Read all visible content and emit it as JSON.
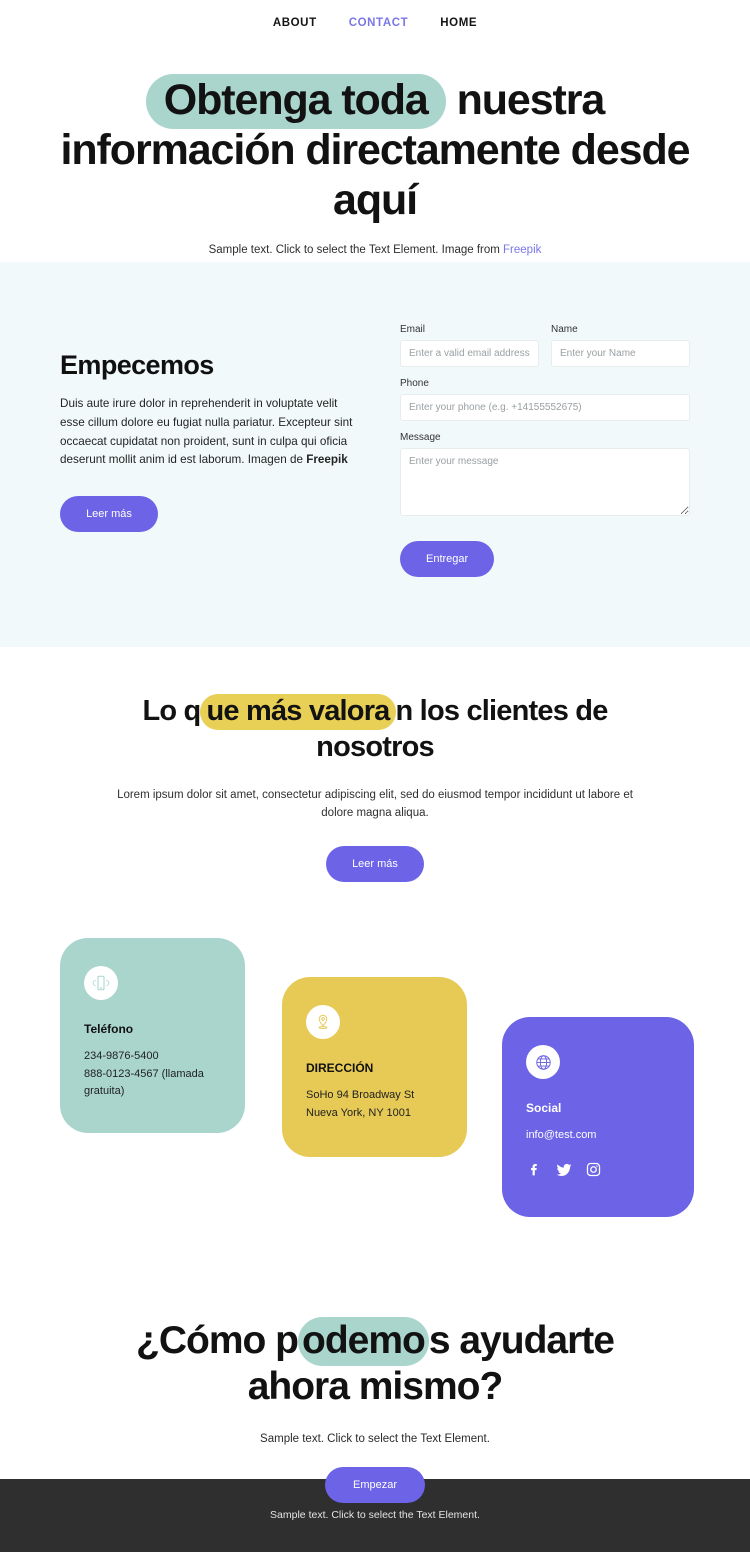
{
  "nav": {
    "items": [
      {
        "label": "ABOUT",
        "active": false
      },
      {
        "label": "CONTACT",
        "active": true
      },
      {
        "label": "HOME",
        "active": false
      }
    ]
  },
  "hero": {
    "title_highlight": "Obtenga toda",
    "title_rest": "nuestra información directamente desde aquí",
    "subtitle": "Sample text. Click to select the Text Element. Image from ",
    "subtitle_link": "Freepik",
    "highlight_color": "#a9d5cd"
  },
  "form_section": {
    "heading": "Empecemos",
    "body_text": "Duis aute irure dolor in reprehenderit in voluptate velit esse cillum dolore eu fugiat nulla pariatur. Excepteur sint occaecat cupidatat non proident, sunt in culpa qui oficia deserunt mollit anim id est laborum. Imagen de ",
    "body_bold": "Freepik",
    "read_more_label": "Leer más",
    "background_color": "#f1f9fa",
    "fields": {
      "email_label": "Email",
      "email_placeholder": "Enter a valid email address",
      "name_label": "Name",
      "name_placeholder": "Enter your Name",
      "phone_label": "Phone",
      "phone_placeholder": "Enter your phone (e.g. +14155552675)",
      "message_label": "Message",
      "message_placeholder": "Enter your message"
    },
    "submit_label": "Entregar"
  },
  "testimonials": {
    "title_part1": "Lo q",
    "title_highlight": "ue más valora",
    "title_part2": "n los clientes de nosotros",
    "subtitle": "Lorem ipsum dolor sit amet, consectetur adipiscing elit, sed do eiusmod tempor incididunt ut labore et dolore magna aliqua.",
    "read_more_label": "Leer más",
    "highlight_color": "#e8cf55"
  },
  "cards": [
    {
      "icon": "mobile-phone-icon",
      "title": "Teléfono",
      "text": "234-9876-5400\n888-0123-4567 (llamada gratuita)",
      "color": "#a9d5cd"
    },
    {
      "icon": "location-pin-icon",
      "title": "DIRECCIÓN",
      "text": "SoHo 94 Broadway St Nueva York, NY 1001",
      "color": "#e6ca55"
    },
    {
      "icon": "globe-icon",
      "title": "Social",
      "text": "info@test.com",
      "color": "#6c63e6",
      "social": [
        "facebook-icon",
        "twitter-icon",
        "instagram-icon"
      ]
    }
  ],
  "cta": {
    "title_part1": "¿Cómo p",
    "title_highlight": "odemo",
    "title_part2": "s ayudarte ahora mismo?",
    "subtitle": "Sample text. Click to select the Text Element.",
    "button_label": "Empezar"
  },
  "footer": {
    "text": "Sample text. Click to select the Text Element.",
    "background_color": "#2f2f2f"
  }
}
